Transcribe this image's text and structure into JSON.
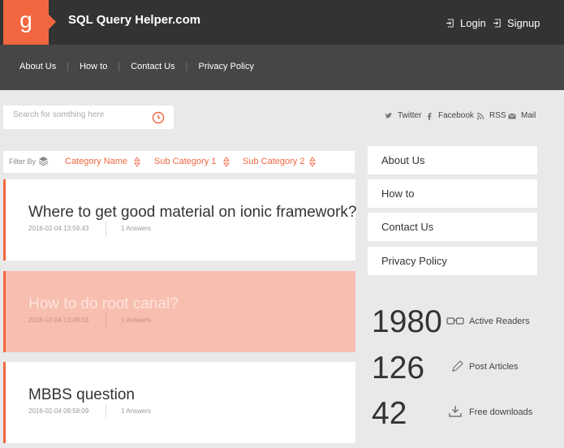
{
  "header": {
    "logo_letter": "g",
    "site_title": "SQL Query Helper.com",
    "login_label": "Login",
    "signup_label": "Signup"
  },
  "nav": {
    "items": [
      {
        "label": "About Us"
      },
      {
        "label": "How to"
      },
      {
        "label": "Contact Us"
      },
      {
        "label": "Privacy Policy"
      }
    ],
    "separator": "|"
  },
  "search": {
    "placeholder": "Search for somthing here",
    "icon": "clock-icon"
  },
  "social": {
    "twitter": "Twitter",
    "facebook": "Facebook",
    "rss": "RSS",
    "mail": "Mail"
  },
  "filter": {
    "label": "Filter By",
    "categories": [
      "Category Name",
      "Sub Category 1",
      "Sub Category 2"
    ]
  },
  "questions": [
    {
      "title": "Where to get good material on ionic framework?",
      "date": "2016-02-04 13:59:43",
      "answers": "1 Answers"
    },
    {
      "title": "How to do root canal?",
      "date": "2016-02-04 13:49:03",
      "answers": "1 Answers"
    },
    {
      "title": "MBBS question",
      "date": "2016-02-04 09:58:09",
      "answers": "1 Answers"
    }
  ],
  "side_menu": {
    "items": [
      {
        "label": "About Us"
      },
      {
        "label": "How to"
      },
      {
        "label": "Contact Us"
      },
      {
        "label": "Privacy Policy"
      }
    ]
  },
  "stats": [
    {
      "value": "1980",
      "label": "Active Readers",
      "icon": "glasses-icon"
    },
    {
      "value": "126",
      "label": "Post Articles",
      "icon": "pencil-icon"
    },
    {
      "value": "42",
      "label": "Free downloads",
      "icon": "download-icon"
    }
  ],
  "colors": {
    "accent": "#f2663f",
    "header_bg": "#333333",
    "nav_bg": "#464646",
    "page_bg": "#e9e9e9",
    "highlight_card": "#f8beb0"
  }
}
